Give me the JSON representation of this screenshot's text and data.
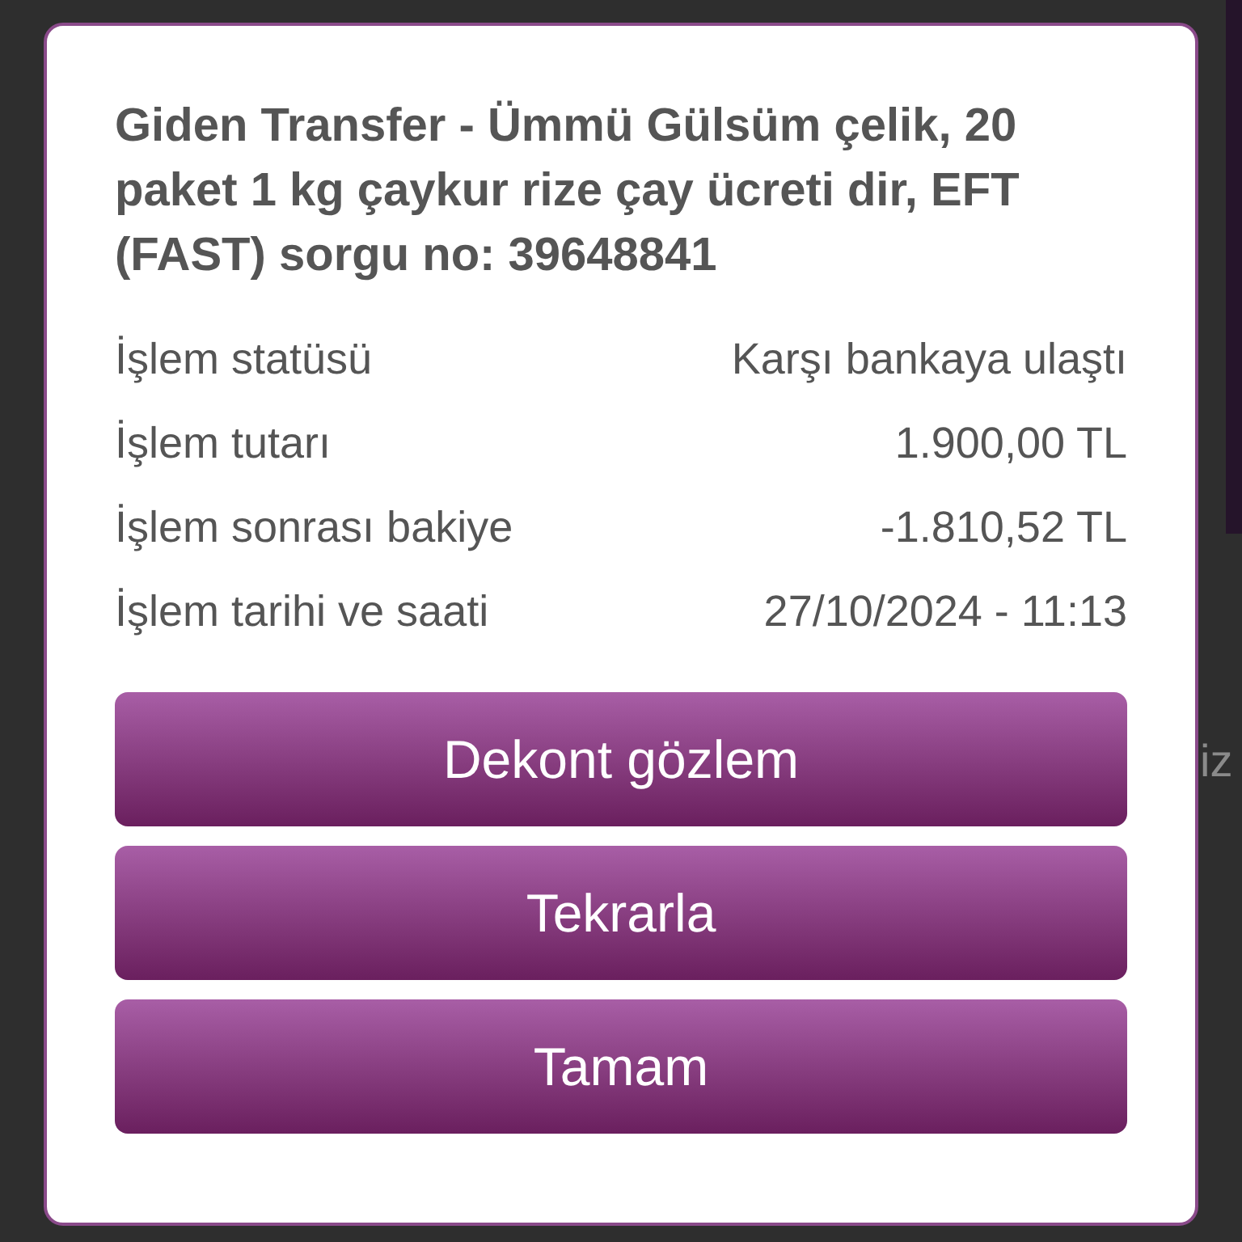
{
  "background": {
    "partial_text": "iz"
  },
  "dialog": {
    "title": "Giden Transfer - Ümmü Gülsüm çelik, 20 paket 1 kg çaykur rize çay ücreti dir, EFT (FAST) sorgu no: 39648841",
    "details": [
      {
        "label": "İşlem statüsü",
        "value": "Karşı bankaya ulaştı"
      },
      {
        "label": "İşlem tutarı",
        "value": "1.900,00 TL"
      },
      {
        "label": "İşlem sonrası bakiye",
        "value": "-1.810,52 TL"
      },
      {
        "label": "İşlem tarihi ve saati",
        "value": "27/10/2024 - 11:13"
      }
    ],
    "buttons": [
      "Dekont gözlem",
      "Tekrarla",
      "Tamam"
    ]
  }
}
